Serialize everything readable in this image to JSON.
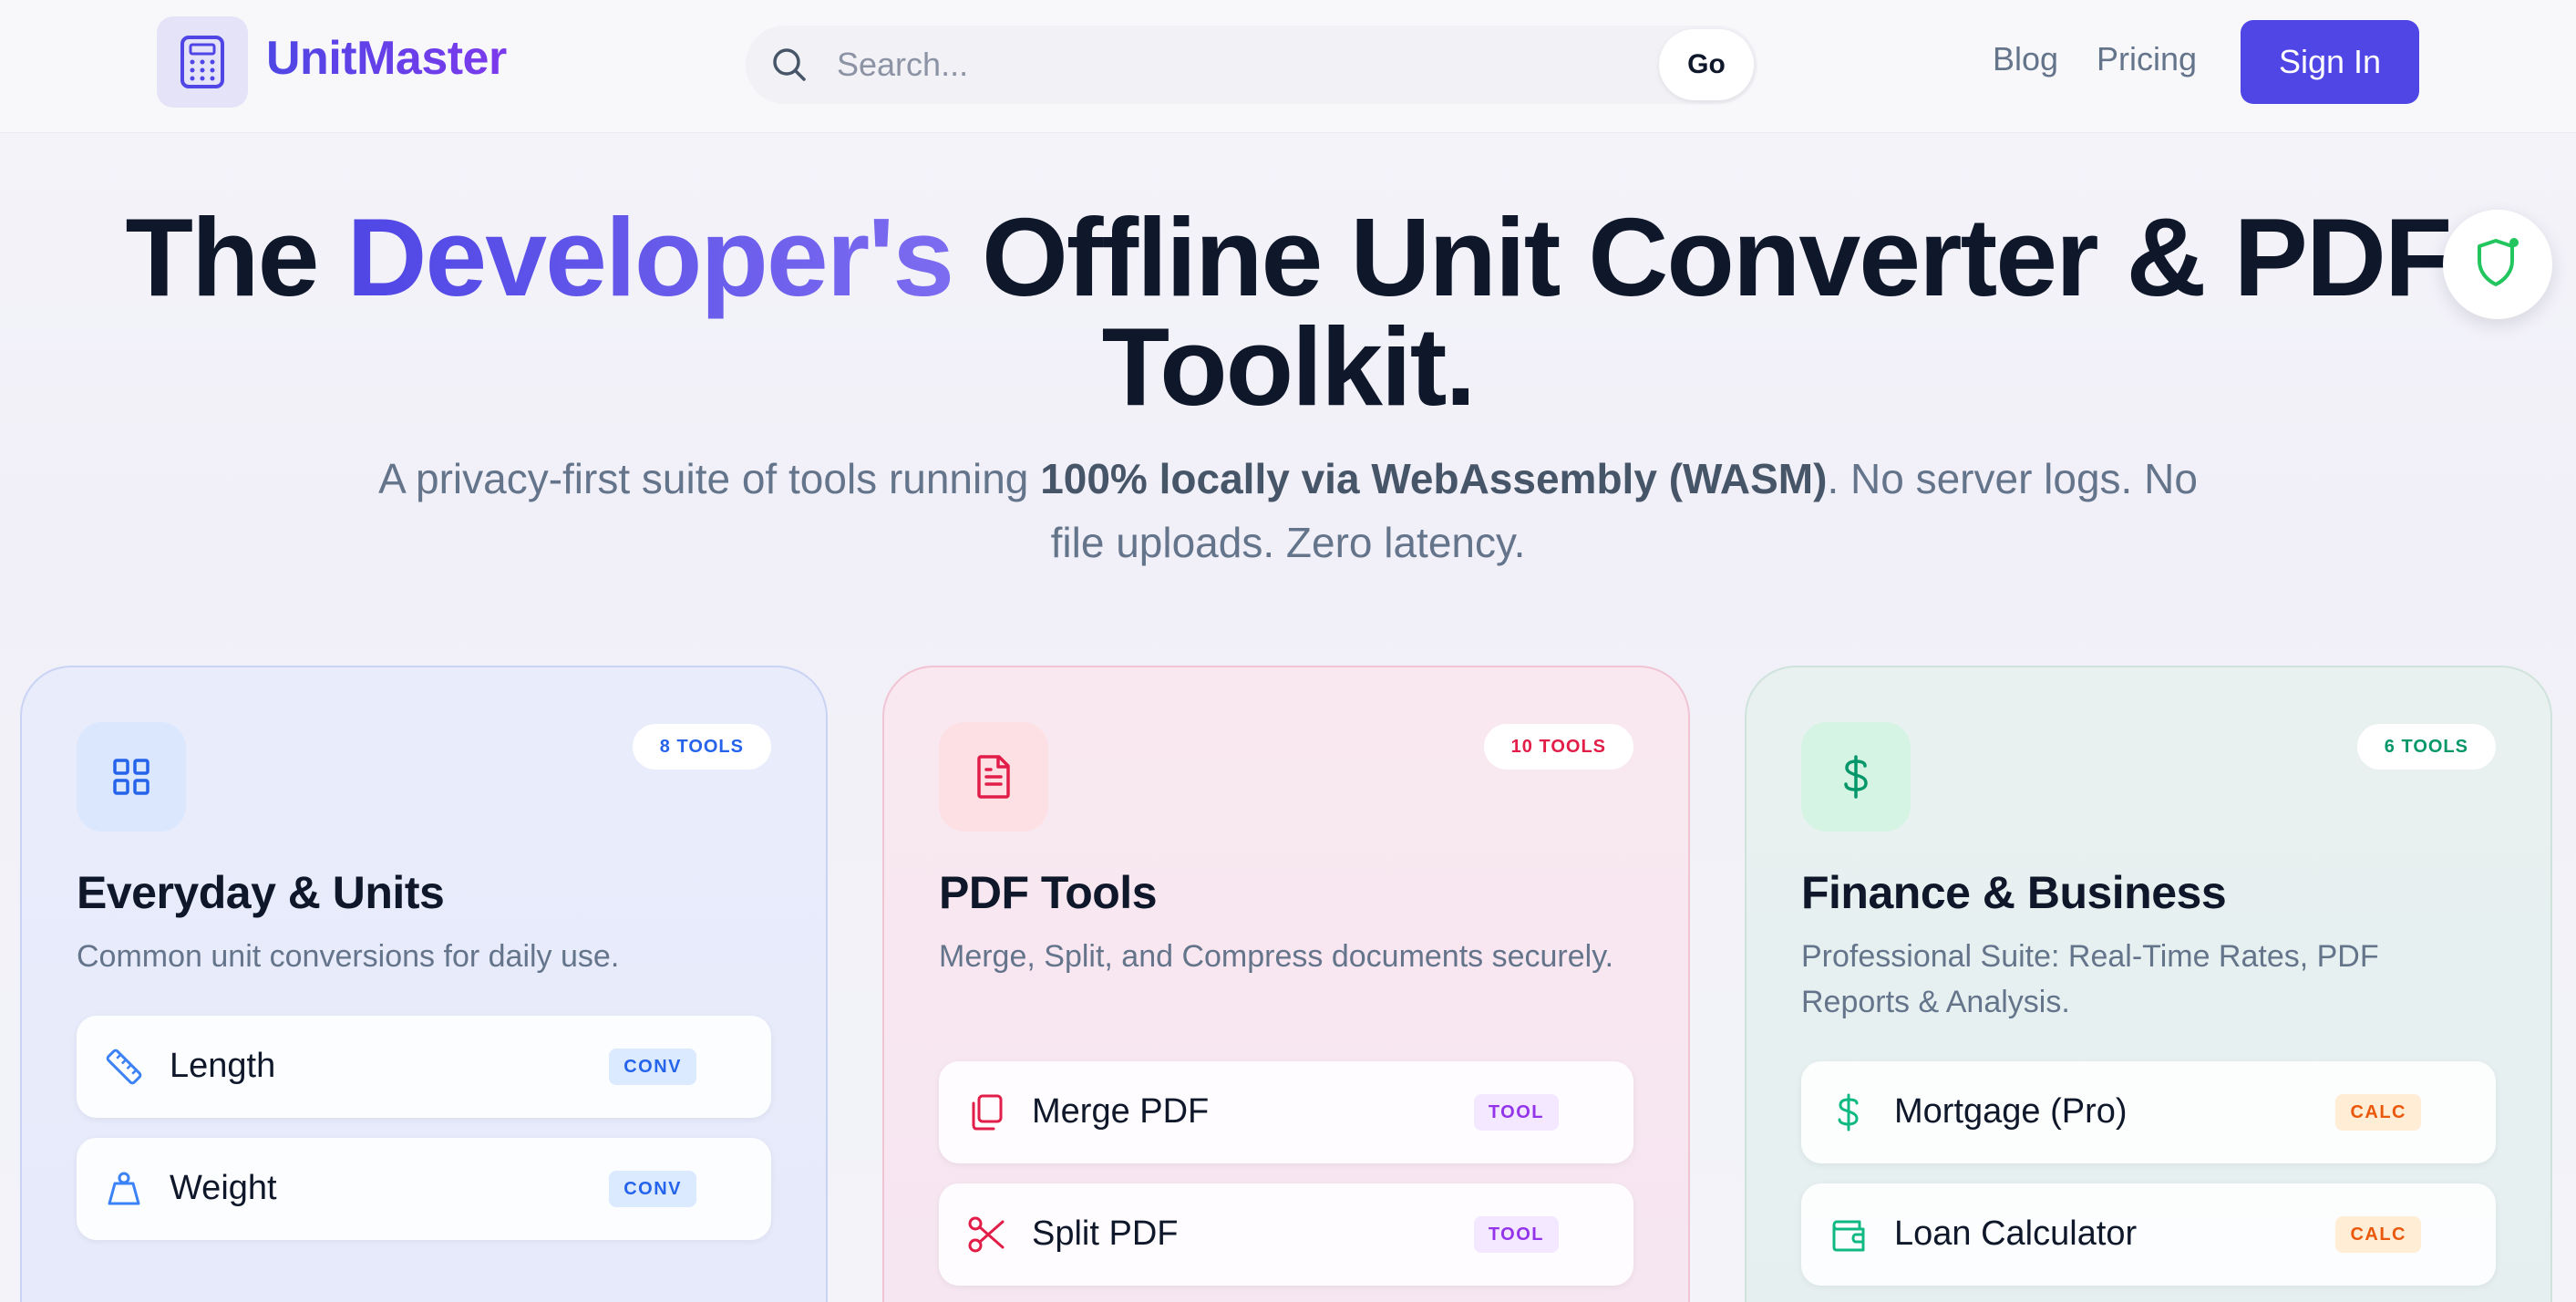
{
  "header": {
    "logo_text": "UnitMaster",
    "search_placeholder": "Search...",
    "go_label": "Go",
    "nav": [
      "Blog",
      "Pricing"
    ],
    "signin_label": "Sign In"
  },
  "hero": {
    "title_prefix": "The ",
    "title_accent": "Developer's",
    "title_suffix": " Offline Unit Converter & PDF Toolkit.",
    "subtitle_pre": "A privacy-first suite of tools running ",
    "subtitle_bold": "100% locally via WebAssembly (WASM)",
    "subtitle_post": ". No server logs. No file uploads. Zero latency."
  },
  "cards": [
    {
      "title": "Everyday & Units",
      "count": "8 TOOLS",
      "description": "Common unit conversions for daily use.",
      "icon": "grid-icon",
      "accent": "#2563eb",
      "items": [
        {
          "label": "Length",
          "tag": "CONV",
          "icon": "ruler-icon"
        },
        {
          "label": "Weight",
          "tag": "CONV",
          "icon": "weight-icon"
        }
      ]
    },
    {
      "title": "PDF Tools",
      "count": "10 TOOLS",
      "description": "Merge, Split, and Compress documents securely.",
      "icon": "document-icon",
      "accent": "#e11d48",
      "items": [
        {
          "label": "Merge PDF",
          "tag": "TOOL",
          "icon": "copy-icon"
        },
        {
          "label": "Split PDF",
          "tag": "TOOL",
          "icon": "scissors-icon"
        }
      ]
    },
    {
      "title": "Finance & Business",
      "count": "6 TOOLS",
      "description": "Professional Suite: Real-Time Rates, PDF Reports & Analysis.",
      "icon": "dollar-icon",
      "accent": "#059669",
      "items": [
        {
          "label": "Mortgage (Pro)",
          "tag": "CALC",
          "icon": "dollar-icon"
        },
        {
          "label": "Loan Calculator",
          "tag": "CALC",
          "icon": "wallet-icon"
        }
      ]
    }
  ],
  "colors": {
    "primary": "#4f46e5",
    "shield": "#22c55e"
  }
}
